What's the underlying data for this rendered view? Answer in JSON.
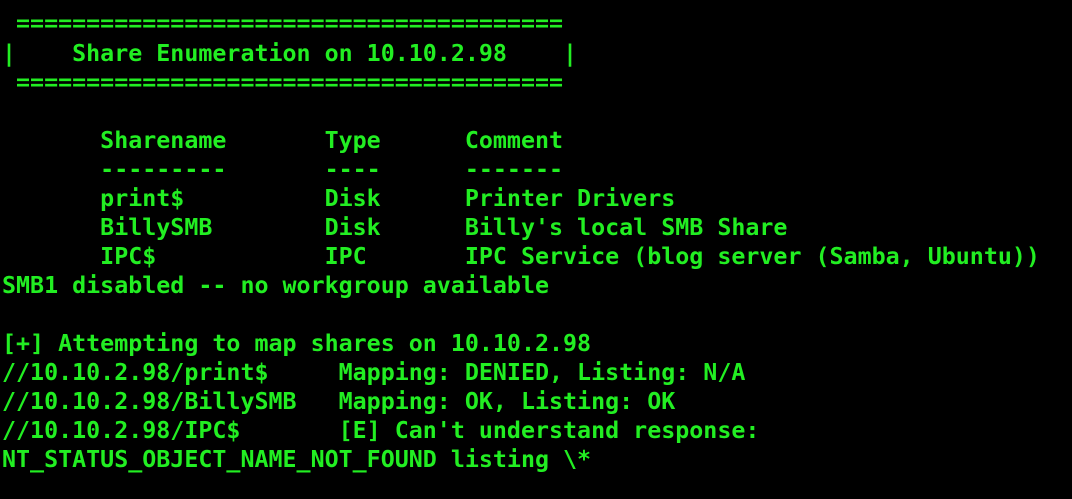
{
  "terminal": {
    "foreground": "#22ee22",
    "background": "#000000",
    "lines": [
      " =======================================",
      "|    Share Enumeration on 10.10.2.98    |",
      " =======================================",
      "",
      "       Sharename       Type      Comment",
      "       ---------       ----      -------",
      "       print$          Disk      Printer Drivers",
      "       BillySMB        Disk      Billy's local SMB Share",
      "       IPC$            IPC       IPC Service (blog server (Samba, Ubuntu))",
      "SMB1 disabled -- no workgroup available",
      "",
      "[+] Attempting to map shares on 10.10.2.98",
      "//10.10.2.98/print$     Mapping: DENIED, Listing: N/A",
      "//10.10.2.98/BillySMB   Mapping: OK, Listing: OK",
      "//10.10.2.98/IPC$       [E] Can't understand response:",
      "NT_STATUS_OBJECT_NAME_NOT_FOUND listing \\*"
    ]
  }
}
